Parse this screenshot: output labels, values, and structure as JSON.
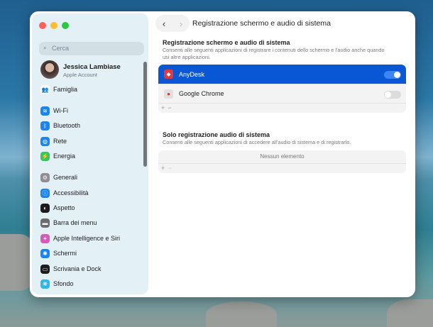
{
  "sidebar": {
    "search_placeholder": "Cerca",
    "account": {
      "name": "Jessica Lambiase",
      "subtitle": "Apple Account"
    },
    "items": [
      {
        "label": "Famiglia",
        "icon": "family-icon",
        "color": "#ffffff"
      },
      {
        "label": "Wi-Fi",
        "icon": "wifi-icon",
        "color": "#1a84f0"
      },
      {
        "label": "Bluetooth",
        "icon": "bluetooth-icon",
        "color": "#1a84f0"
      },
      {
        "label": "Rete",
        "icon": "network-icon",
        "color": "#1a84f0"
      },
      {
        "label": "Energia",
        "icon": "battery-icon",
        "color": "#34c759"
      },
      {
        "label": "Generali",
        "icon": "gear-icon",
        "color": "#8e8e93"
      },
      {
        "label": "Accessibilità",
        "icon": "accessibility-icon",
        "color": "#1a84f0"
      },
      {
        "label": "Aspetto",
        "icon": "appearance-icon",
        "color": "#1c1c1e"
      },
      {
        "label": "Barra dei menu",
        "icon": "menubar-icon",
        "color": "#6b6b70"
      },
      {
        "label": "Apple Intelligence e Siri",
        "icon": "siri-icon",
        "color": "#d85ab8"
      },
      {
        "label": "Schermi",
        "icon": "display-icon",
        "color": "#1a84f0"
      },
      {
        "label": "Scrivania e Dock",
        "icon": "dock-icon",
        "color": "#1c1c1e"
      },
      {
        "label": "Sfondo",
        "icon": "wallpaper-icon",
        "color": "#2fb5e8"
      }
    ]
  },
  "header": {
    "title": "Registrazione schermo e audio di sistema"
  },
  "section1": {
    "heading": "Registrazione schermo e audio di sistema",
    "description": "Consenti alle seguenti applicazioni di registrare i contenuti dello schermo e l'audio anche quando usi altre applicazioni.",
    "apps": [
      {
        "name": "AnyDesk",
        "enabled": true,
        "selected": true,
        "color": "#e0393e"
      },
      {
        "name": "Google Chrome",
        "enabled": false,
        "selected": false,
        "color": "#e8e8e8"
      }
    ]
  },
  "section2": {
    "heading": "Solo registrazione audio di sistema",
    "description": "Consenti alle seguenti applicazioni di accedere all'audio di sistema e di registrarlo.",
    "empty_label": "Nessun elemento"
  },
  "controls": {
    "add": "+",
    "remove": "−"
  },
  "colors": {
    "accent": "#0a57d6"
  }
}
